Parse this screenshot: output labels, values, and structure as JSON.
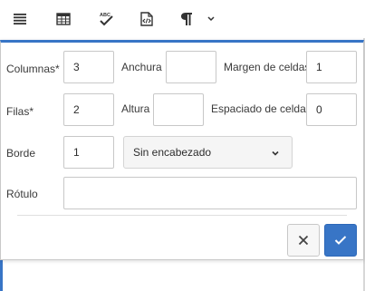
{
  "toolbar": {
    "buttons": [
      {
        "icon": "align-justify-icon"
      },
      {
        "icon": "table-icon"
      },
      {
        "icon": "spellcheck-icon",
        "glyph_text": "ABC"
      },
      {
        "icon": "html-source-icon"
      },
      {
        "icon": "paragraph-icon"
      },
      {
        "icon": "chevron-down-icon"
      }
    ]
  },
  "dialog": {
    "columns_label": "Columnas*",
    "columns_value": "3",
    "width_label": "Anchura",
    "width_value": "",
    "cell_padding_label": "Margen de celdas",
    "cell_padding_value": "1",
    "rows_label": "Filas*",
    "rows_value": "2",
    "height_label": "Altura",
    "height_value": "",
    "cell_spacing_label": "Espaciado de celdas",
    "cell_spacing_value": "0",
    "border_label": "Borde",
    "border_value": "1",
    "header_select_value": "Sin encabezado",
    "caption_label": "Rótulo",
    "caption_value": "",
    "cancel_icon": "close-icon",
    "confirm_icon": "check-icon"
  },
  "colors": {
    "accent": "#3875c6",
    "border": "#c8c8c8",
    "text": "#2c2c2c"
  }
}
